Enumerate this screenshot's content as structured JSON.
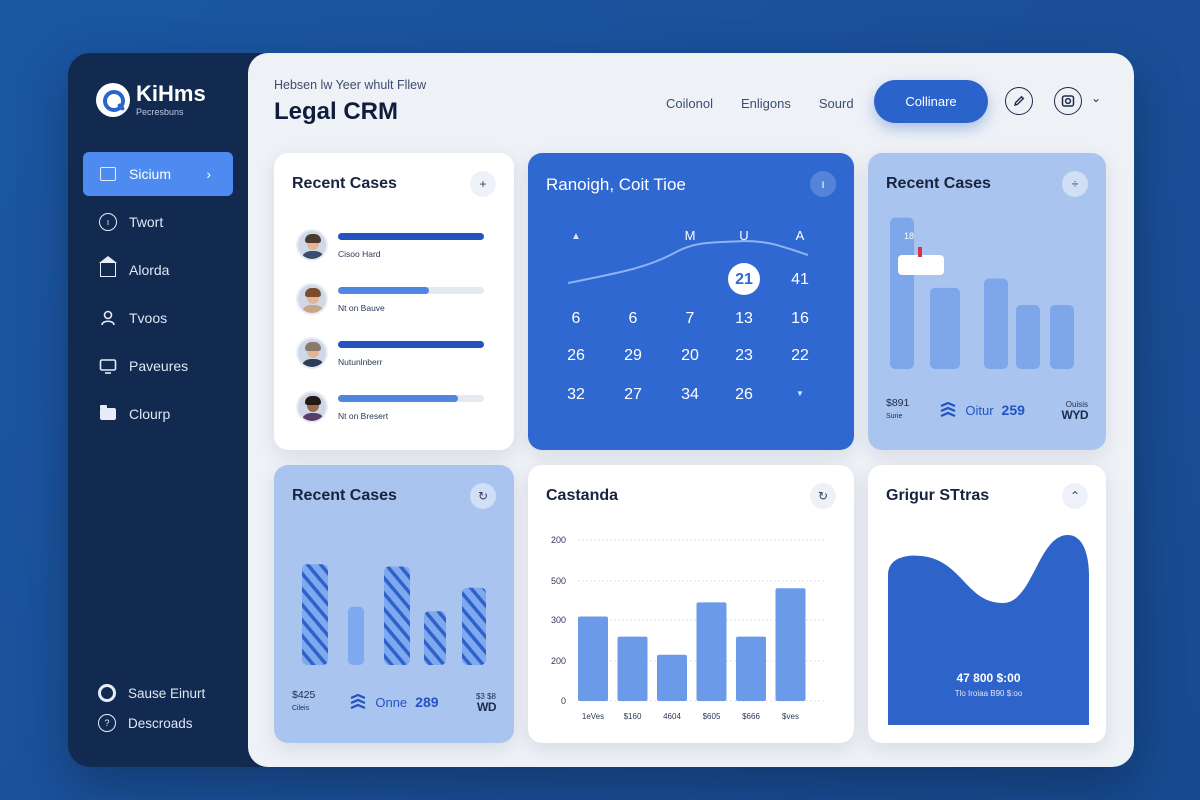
{
  "brand": {
    "name": "KiHms",
    "tagline": "Pecresbuns"
  },
  "nav": {
    "items": [
      {
        "label": "Sicium",
        "icon": "calendar-icon",
        "active": true
      },
      {
        "label": "Twort",
        "icon": "clock-icon"
      },
      {
        "label": "Alorda",
        "icon": "home-icon"
      },
      {
        "label": "Tvoos",
        "icon": "users-icon"
      },
      {
        "label": "Paveures",
        "icon": "monitor-icon"
      },
      {
        "label": "Clourp",
        "icon": "folder-icon"
      }
    ],
    "bottom": [
      {
        "label": "Sause Einurt",
        "icon": "help-icon"
      },
      {
        "label": "Descroads",
        "icon": "settings-icon"
      }
    ]
  },
  "header": {
    "subtitle": "Hebsen lw Yeer whult Fllew",
    "title": "Legal CRM",
    "links": [
      "Coilonol",
      "Enligons",
      "Sourd"
    ],
    "primary_button": "Collinare",
    "edit_icon": "pencil-icon",
    "profile_icon": "camera-icon"
  },
  "cases_card": {
    "title": "Recent Cases",
    "rows": [
      {
        "name": "Cisoo Hard",
        "progress": 1.0
      },
      {
        "name": "Nt on Bauve",
        "progress": 0.62
      },
      {
        "name": "Nutunlnberr",
        "progress": 1.0
      },
      {
        "name": "Nt on Bresert",
        "progress": 0.82
      }
    ]
  },
  "calendar_card": {
    "title": "Ranoigh, Coit Tioe",
    "header_marks": [
      "M",
      "U",
      "A"
    ],
    "rows": [
      [
        "",
        "",
        "",
        "21",
        "41"
      ],
      [
        "6",
        "6",
        "7",
        "13",
        "16"
      ],
      [
        "26",
        "29",
        "20",
        "23",
        "22"
      ],
      [
        "32",
        "27",
        "34",
        "26",
        ""
      ]
    ],
    "selected": "21"
  },
  "cases_card_2": {
    "title": "Recent Cases",
    "marker_value": "18",
    "bars": [
      0.97,
      0.52,
      0.58,
      0.41,
      0.41
    ],
    "footer": {
      "amount": "$891",
      "sub": "Surie",
      "label": "Oitur",
      "value": "259",
      "right_top": "Ouisis",
      "right_bottom": "WYD"
    }
  },
  "cases_card_3": {
    "title": "Recent Cases",
    "bars": [
      {
        "height": 0.9,
        "striped": true
      },
      {
        "height": 0.52,
        "striped": false
      },
      {
        "height": 0.88,
        "striped": true
      },
      {
        "height": 0.48,
        "striped": true
      },
      {
        "height": 0.69,
        "striped": true
      }
    ],
    "footer": {
      "amount": "$425",
      "sub": "Cileis",
      "label": "Onne",
      "value": "289",
      "right_top": "$3 $8",
      "right_bottom": "WD"
    }
  },
  "chart_card": {
    "title": "Castanda",
    "button_icon": "refresh-icon"
  },
  "chart_data": {
    "type": "bar",
    "categories": [
      "1eVes",
      "$160",
      "4604",
      "$605",
      "$666",
      "$ves"
    ],
    "values": [
      210,
      160,
      115,
      245,
      160,
      280
    ],
    "y_ticks": [
      "200",
      "500",
      "300",
      "200",
      "0"
    ],
    "ylim": [
      0,
      400
    ],
    "grid": true
  },
  "stats_card": {
    "title": "Grigur STtras",
    "value": "47 800 $:00",
    "sub": "Tlo Iroiaa B90 $:oo"
  }
}
